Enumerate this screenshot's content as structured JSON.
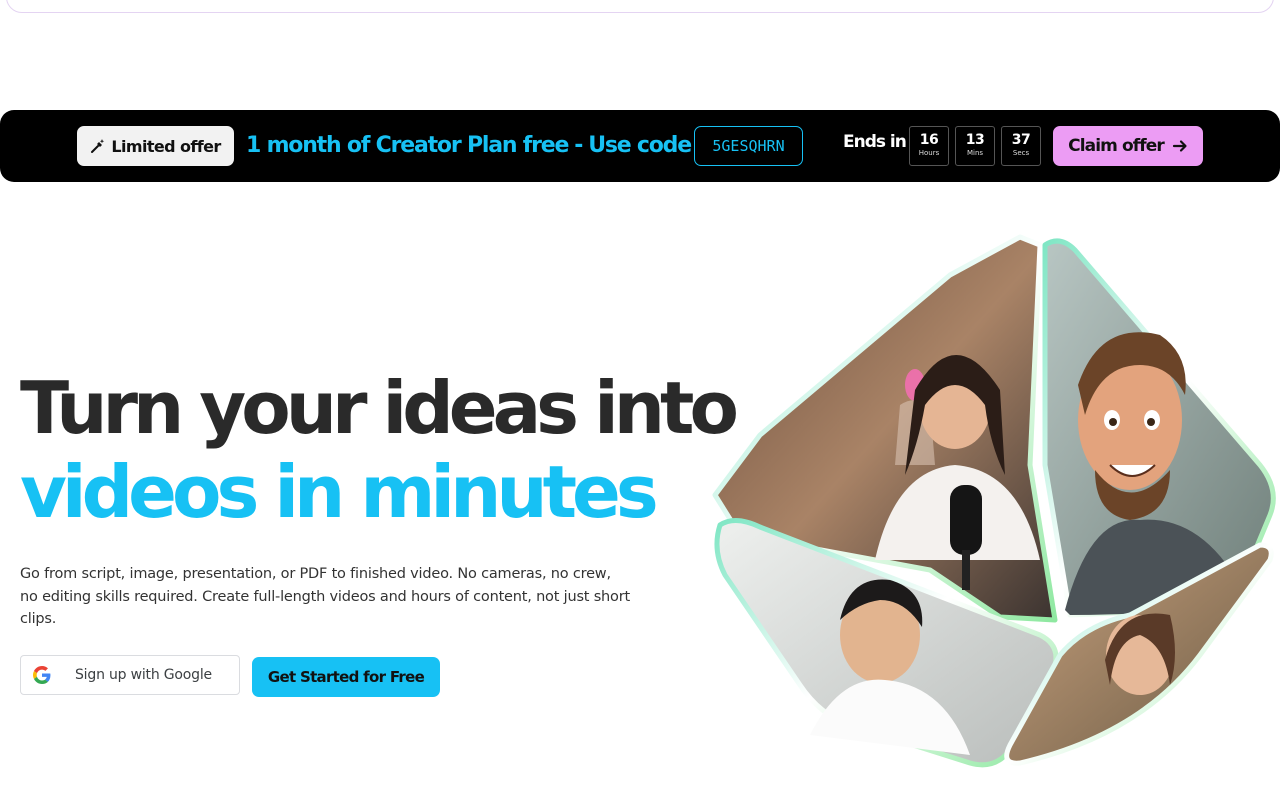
{
  "promo": {
    "badge_label": "Limited offer",
    "headline": "1 month of Creator Plan free",
    "separator": "-",
    "use_code_label": "Use code",
    "code": "5GESQHRN",
    "ends_in_label": "Ends in",
    "countdown": [
      {
        "value": "16",
        "unit": "Hours"
      },
      {
        "value": "13",
        "unit": "Mins"
      },
      {
        "value": "37",
        "unit": "Secs"
      }
    ],
    "claim_label": "Claim offer"
  },
  "hero": {
    "title_line1": "Turn your ideas into",
    "title_line2": "videos in minutes",
    "subtitle": "Go from script, image, presentation, or PDF to finished video. No cameras, no crew, no editing skills required. Create full-length videos and hours of content, not just short clips.",
    "google_button_label": "Sign up with Google",
    "cta_label": "Get Started for Free"
  },
  "colors": {
    "accent_cyan": "#17c1f4",
    "accent_pink": "#ec9cf4",
    "promo_bg": "#000000",
    "title_dark": "#2a2a2a"
  },
  "icons": {
    "badge": "sparkle-pen-icon",
    "claim": "arrow-right-icon",
    "google": "google-logo-icon"
  }
}
